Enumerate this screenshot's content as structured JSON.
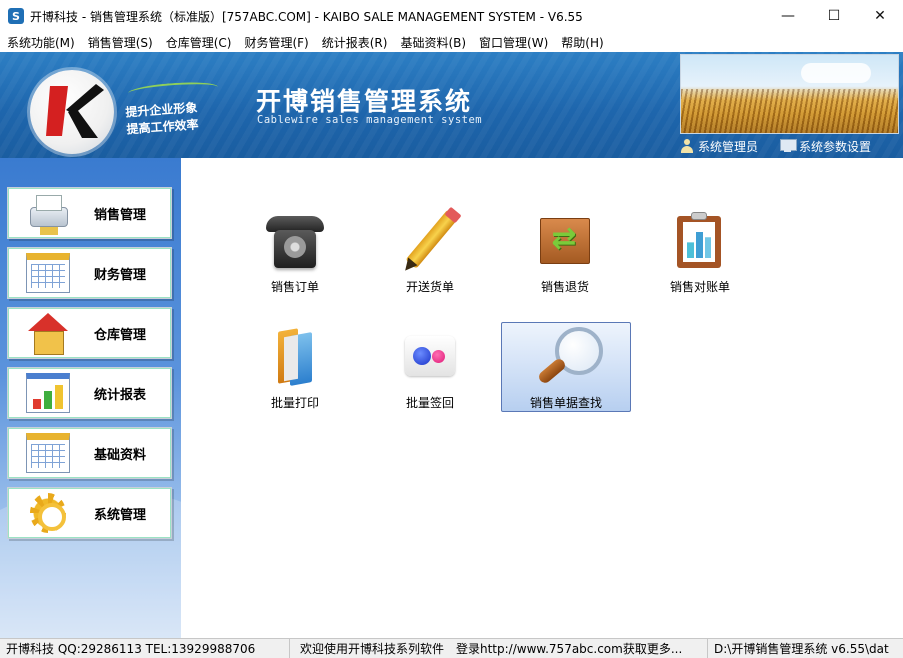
{
  "window": {
    "title": "开博科技 - 销售管理系统（标准版）[757ABC.COM] - KAIBO SALE MANAGEMENT SYSTEM - V6.55",
    "minimize_glyph": "—",
    "maximize_glyph": "☐",
    "close_glyph": "✕"
  },
  "menubar": {
    "items": [
      "系统功能(M)",
      "销售管理(S)",
      "仓库管理(C)",
      "财务管理(F)",
      "统计报表(R)",
      "基础资料(B)",
      "窗口管理(W)",
      "帮助(H)"
    ]
  },
  "banner": {
    "slogan_line1": "提升企业形象",
    "slogan_line2": "提高工作效率",
    "title": "开博销售管理系统",
    "subtitle": "Cablewire sales management system",
    "user_link": "系统管理员",
    "settings_link": "系统参数设置"
  },
  "sidebar": {
    "items": [
      {
        "label": "销售管理",
        "icon": "printer-icon"
      },
      {
        "label": "财务管理",
        "icon": "calendar-icon"
      },
      {
        "label": "仓库管理",
        "icon": "house-icon"
      },
      {
        "label": "统计报表",
        "icon": "chart-icon"
      },
      {
        "label": "基础资料",
        "icon": "calendar-icon"
      },
      {
        "label": "系统管理",
        "icon": "gear-icon"
      }
    ]
  },
  "main": {
    "tiles": [
      {
        "label": "销售订单",
        "icon": "telephone-icon"
      },
      {
        "label": "开送货单",
        "icon": "pencil-icon"
      },
      {
        "label": "销售退货",
        "icon": "return-box-icon"
      },
      {
        "label": "销售对账单",
        "icon": "clipboard-chart-icon"
      },
      {
        "label": "批量打印",
        "icon": "books-icon"
      },
      {
        "label": "批量签回",
        "icon": "dots-icon"
      },
      {
        "label": "销售单据查找",
        "icon": "magnifier-icon",
        "selected": true
      }
    ]
  },
  "statusbar": {
    "company": "开博科技 QQ:29286113 TEL:13929988706",
    "message": "欢迎使用开博科技系列软件　登录http://www.757abc.com获取更多...",
    "path": "D:\\开博销售管理系统 v6.55\\dat"
  },
  "colors": {
    "banner_blue": "#1e66ad",
    "selection_border": "#5a78b6"
  }
}
